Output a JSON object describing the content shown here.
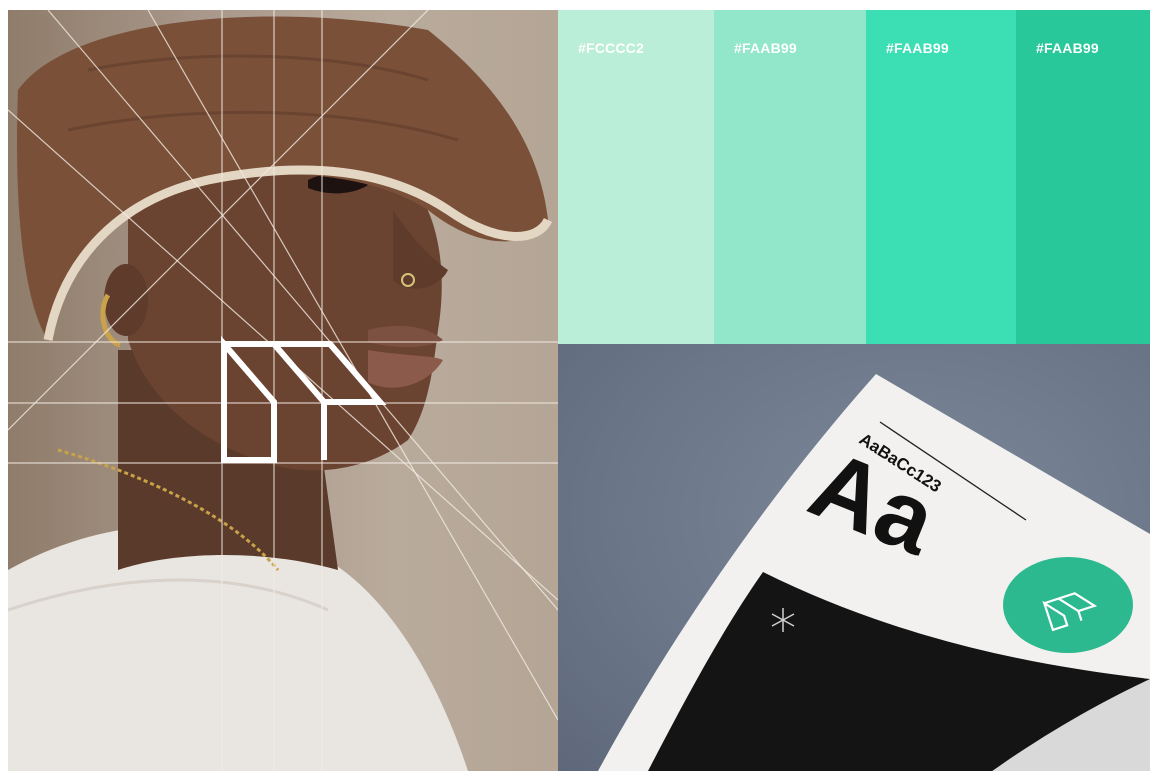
{
  "portrait": {
    "logo_icon": "np-monogram-icon"
  },
  "palette": {
    "swatches": [
      {
        "hex": "#FCCCC2",
        "color": "#BAEED9"
      },
      {
        "hex": "#FAAB99",
        "color": "#92E6C9"
      },
      {
        "hex": "#FAAB99",
        "color": "#3CDFB4"
      },
      {
        "hex": "#FAAB99",
        "color": "#28C89A"
      }
    ]
  },
  "specimen": {
    "sample_line": "AaBaCc123",
    "glyph": "Aa",
    "badge_color": "#2DB98F",
    "badge_icon": "np-monogram-icon",
    "sparkle_icon": "asterisk-icon"
  }
}
